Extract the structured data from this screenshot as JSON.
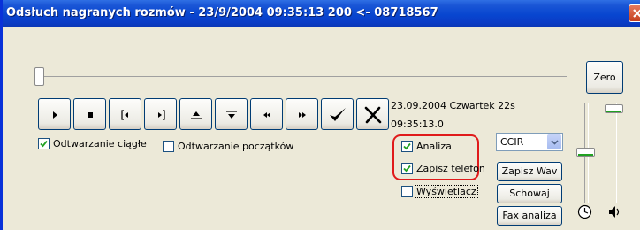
{
  "window": {
    "title": "Odsłuch nagranych rozmów - 23/9/2004 09:35:13 200 <- 08718567"
  },
  "buttons": {
    "zero": "Zero",
    "zapisz_wav": "Zapisz Wav",
    "schowaj": "Schowaj",
    "fax_analiza": "Fax analiza"
  },
  "transport": [
    {
      "name": "play-button",
      "icon": "play-icon"
    },
    {
      "name": "stop-button",
      "icon": "stop-icon"
    },
    {
      "name": "mark-start-button",
      "icon": "bracket-left-icon"
    },
    {
      "name": "mark-end-button",
      "icon": "bracket-right-icon"
    },
    {
      "name": "jump-up-button",
      "icon": "arrow-up-icon"
    },
    {
      "name": "jump-down-button",
      "icon": "arrow-down-icon"
    },
    {
      "name": "rewind-button",
      "icon": "rewind-icon"
    },
    {
      "name": "forward-button",
      "icon": "fast-forward-icon"
    },
    {
      "name": "accept-button",
      "icon": "checkmark-icon"
    },
    {
      "name": "reject-button",
      "icon": "x-mark-icon"
    }
  ],
  "info": {
    "date_line": "23.09.2004 Czwartek  22s",
    "time_line": "09:35:13.0"
  },
  "checkboxes": {
    "odtwarzanie_ciagle": {
      "label": "Odtwarzanie ciągłe",
      "checked": true
    },
    "odtwarzanie_poczatkow": {
      "label": "Odtwarzanie początków",
      "checked": false
    },
    "analiza": {
      "label": "Analiza",
      "checked": true
    },
    "zapisz_telefon": {
      "label": "Zapisz telefon",
      "checked": true
    },
    "wyswietlacz": {
      "label": "Wyświetlacz",
      "checked": false
    }
  },
  "standard_select": {
    "value": "CCIR"
  },
  "icons": {
    "left_slider": "clock-icon",
    "right_slider": "speaker-icon"
  },
  "colors": {
    "titlebar": "#0846d0",
    "highlight": "#e01b1b",
    "check": "#21a121"
  }
}
